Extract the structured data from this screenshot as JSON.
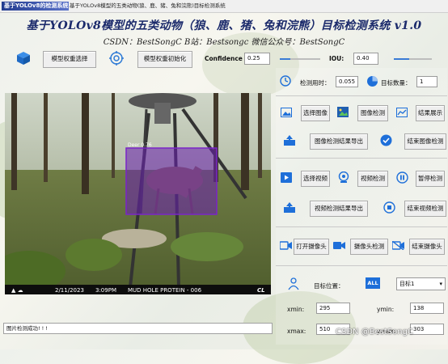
{
  "window": {
    "logo_text": "基于YOLOv8的检测系统",
    "title": "基于YOLOv8模型的五类动物(狼、鹿、猪、兔和浣熊)目标检测系统"
  },
  "header": {
    "title": "基于YOLOv8模型的五类动物（狼、鹿、猪、兔和浣熊）目标检测系统 v1.0",
    "subtitle": "CSDN：BestSongC   B站：Bestsongc   微信公众号：BestSongC"
  },
  "toolbar": {
    "weights_select_label": "模型权重选择",
    "weights_init_label": "模型权重初始化",
    "confidence_label": "Confidence",
    "confidence_value": "0.25",
    "confidence_level": 0.25,
    "iou_label": "IOU:",
    "iou_value": "0.40",
    "iou_level": 0.4
  },
  "image_view": {
    "detection_label": "Deer 0.76",
    "overlay_date": "2/11/2023",
    "overlay_time": "3:09PM",
    "overlay_location": "MUD HOLE PROTEIN - 006",
    "overlay_brand": "CL"
  },
  "stats": {
    "time_label": "检测用时：",
    "time_value": "0.055",
    "count_label": "目标数量：",
    "count_value": "1"
  },
  "image_section": {
    "select_label": "选择图像",
    "detect_label": "图像检测",
    "show_label": "结果展示",
    "export_label": "图像检测结果导出",
    "end_label": "结束图像检测"
  },
  "video_section": {
    "select_label": "选择视频",
    "detect_label": "视频检测",
    "pause_label": "暂停检测",
    "export_label": "视频检测结果导出",
    "end_label": "结束视频检测"
  },
  "camera_section": {
    "open_label": "打开摄像头",
    "detect_label": "摄像头检测",
    "end_label": "结束摄像头"
  },
  "target": {
    "position_label": "目标位置：",
    "all_badge": "ALL",
    "select_value": "目标1",
    "xmin_label": "xmin:",
    "xmin_value": "295",
    "ymin_label": "ymin:",
    "ymin_value": "138",
    "xmax_label": "xmax:",
    "xmax_value": "510",
    "ymax_label": "ymax:",
    "ymax_value": "303"
  },
  "status": {
    "message": "图片检测成功! ! !"
  },
  "watermark": "CSDN @BestSongC",
  "colors": {
    "accent": "#1e6fd9",
    "title": "#1b2a6b",
    "detection_box": "#6a1fb0"
  }
}
